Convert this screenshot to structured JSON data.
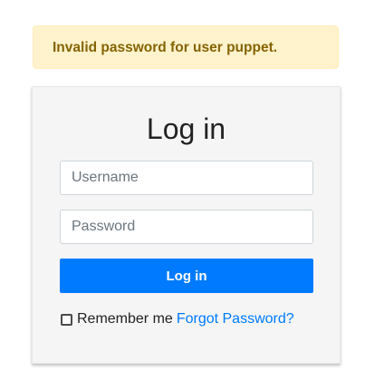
{
  "alert": {
    "message": "Invalid password for user puppet."
  },
  "login_form": {
    "title": "Log in",
    "username_placeholder": "Username",
    "username_value": "",
    "password_placeholder": "Password",
    "password_value": "",
    "submit_label": "Log in",
    "remember_label": "Remember me",
    "remember_checked": false,
    "forgot_label": "Forgot Password?"
  },
  "colors": {
    "alert_background": "#fff3cd",
    "alert_text": "#856404",
    "primary": "#007bff",
    "card_background": "#f5f5f5"
  }
}
